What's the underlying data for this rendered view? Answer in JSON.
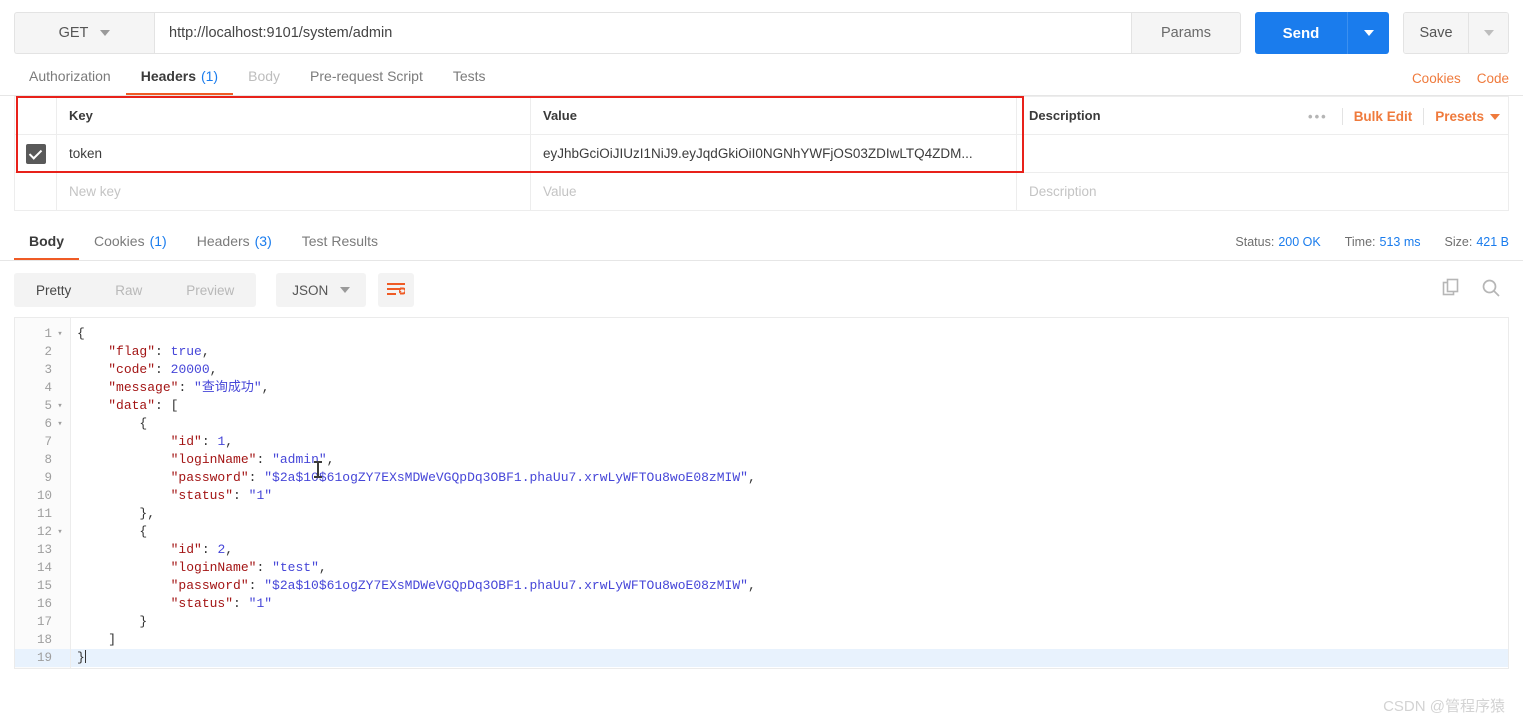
{
  "request": {
    "method": "GET",
    "url": "http://localhost:9101/system/admin",
    "params_label": "Params",
    "send_label": "Send",
    "save_label": "Save",
    "tabs": [
      {
        "label": "Authorization",
        "count": "",
        "state": "normal"
      },
      {
        "label": "Headers",
        "count": "(1)",
        "state": "active"
      },
      {
        "label": "Body",
        "count": "",
        "state": "dim"
      },
      {
        "label": "Pre-request Script",
        "count": "",
        "state": "normal"
      },
      {
        "label": "Tests",
        "count": "",
        "state": "normal"
      }
    ],
    "links": {
      "cookies": "Cookies",
      "code": "Code"
    }
  },
  "headers_table": {
    "columns": [
      "Key",
      "Value",
      "Description"
    ],
    "actions": {
      "dots": "•••",
      "bulk_edit": "Bulk Edit",
      "presets": "Presets"
    },
    "rows": [
      {
        "checked": true,
        "key": "token",
        "value": "eyJhbGciOiJIUzI1NiJ9.eyJqdGkiOiI0NGNhYWFjOS03ZDIwLTQ4ZDM...",
        "description": ""
      }
    ],
    "new_row": {
      "key_placeholder": "New key",
      "value_placeholder": "Value",
      "description_placeholder": "Description"
    }
  },
  "response": {
    "tabs": [
      {
        "label": "Body",
        "count": "",
        "state": "active"
      },
      {
        "label": "Cookies",
        "count": "(1)",
        "state": "normal"
      },
      {
        "label": "Headers",
        "count": "(3)",
        "state": "normal"
      },
      {
        "label": "Test Results",
        "count": "",
        "state": "normal"
      }
    ],
    "meta": {
      "status_label": "Status:",
      "status_value": "200 OK",
      "time_label": "Time:",
      "time_value": "513 ms",
      "size_label": "Size:",
      "size_value": "421 B"
    },
    "viewer": {
      "modes": [
        "Pretty",
        "Raw",
        "Preview"
      ],
      "active_mode": "Pretty",
      "format": "JSON",
      "wrap_icon": "word-wrap-icon",
      "copy_icon": "copy-icon",
      "search_icon": "search-icon"
    },
    "body_lines": [
      {
        "n": 1,
        "fold": true,
        "indent": 0,
        "tokens": [
          {
            "t": "p",
            "v": "{"
          }
        ],
        "hl": false
      },
      {
        "n": 2,
        "fold": false,
        "indent": 1,
        "tokens": [
          {
            "t": "k",
            "v": "\"flag\""
          },
          {
            "t": "p",
            "v": ": "
          },
          {
            "t": "n",
            "v": "true"
          },
          {
            "t": "p",
            "v": ","
          }
        ],
        "hl": false
      },
      {
        "n": 3,
        "fold": false,
        "indent": 1,
        "tokens": [
          {
            "t": "k",
            "v": "\"code\""
          },
          {
            "t": "p",
            "v": ": "
          },
          {
            "t": "n",
            "v": "20000"
          },
          {
            "t": "p",
            "v": ","
          }
        ],
        "hl": false
      },
      {
        "n": 4,
        "fold": false,
        "indent": 1,
        "tokens": [
          {
            "t": "k",
            "v": "\"message\""
          },
          {
            "t": "p",
            "v": ": "
          },
          {
            "t": "s",
            "v": "\"查询成功\""
          },
          {
            "t": "p",
            "v": ","
          }
        ],
        "hl": false
      },
      {
        "n": 5,
        "fold": true,
        "indent": 1,
        "tokens": [
          {
            "t": "k",
            "v": "\"data\""
          },
          {
            "t": "p",
            "v": ": ["
          }
        ],
        "hl": false
      },
      {
        "n": 6,
        "fold": true,
        "indent": 2,
        "tokens": [
          {
            "t": "p",
            "v": "{"
          }
        ],
        "hl": false
      },
      {
        "n": 7,
        "fold": false,
        "indent": 3,
        "tokens": [
          {
            "t": "k",
            "v": "\"id\""
          },
          {
            "t": "p",
            "v": ": "
          },
          {
            "t": "n",
            "v": "1"
          },
          {
            "t": "p",
            "v": ","
          }
        ],
        "hl": false
      },
      {
        "n": 8,
        "fold": false,
        "indent": 3,
        "tokens": [
          {
            "t": "k",
            "v": "\"loginName\""
          },
          {
            "t": "p",
            "v": ": "
          },
          {
            "t": "s",
            "v": "\"admin\""
          },
          {
            "t": "p",
            "v": ","
          }
        ],
        "hl": false
      },
      {
        "n": 9,
        "fold": false,
        "indent": 3,
        "tokens": [
          {
            "t": "k",
            "v": "\"password\""
          },
          {
            "t": "p",
            "v": ": "
          },
          {
            "t": "s",
            "v": "\"$2a$10$61ogZY7EXsMDWeVGQpDq3OBF1.phaUu7.xrwLyWFTOu8woE08zMIW\""
          },
          {
            "t": "p",
            "v": ","
          }
        ],
        "hl": false
      },
      {
        "n": 10,
        "fold": false,
        "indent": 3,
        "tokens": [
          {
            "t": "k",
            "v": "\"status\""
          },
          {
            "t": "p",
            "v": ": "
          },
          {
            "t": "s",
            "v": "\"1\""
          }
        ],
        "hl": false
      },
      {
        "n": 11,
        "fold": false,
        "indent": 2,
        "tokens": [
          {
            "t": "p",
            "v": "},"
          }
        ],
        "hl": false
      },
      {
        "n": 12,
        "fold": true,
        "indent": 2,
        "tokens": [
          {
            "t": "p",
            "v": "{"
          }
        ],
        "hl": false
      },
      {
        "n": 13,
        "fold": false,
        "indent": 3,
        "tokens": [
          {
            "t": "k",
            "v": "\"id\""
          },
          {
            "t": "p",
            "v": ": "
          },
          {
            "t": "n",
            "v": "2"
          },
          {
            "t": "p",
            "v": ","
          }
        ],
        "hl": false
      },
      {
        "n": 14,
        "fold": false,
        "indent": 3,
        "tokens": [
          {
            "t": "k",
            "v": "\"loginName\""
          },
          {
            "t": "p",
            "v": ": "
          },
          {
            "t": "s",
            "v": "\"test\""
          },
          {
            "t": "p",
            "v": ","
          }
        ],
        "hl": false
      },
      {
        "n": 15,
        "fold": false,
        "indent": 3,
        "tokens": [
          {
            "t": "k",
            "v": "\"password\""
          },
          {
            "t": "p",
            "v": ": "
          },
          {
            "t": "s",
            "v": "\"$2a$10$61ogZY7EXsMDWeVGQpDq3OBF1.phaUu7.xrwLyWFTOu8woE08zMIW\""
          },
          {
            "t": "p",
            "v": ","
          }
        ],
        "hl": false
      },
      {
        "n": 16,
        "fold": false,
        "indent": 3,
        "tokens": [
          {
            "t": "k",
            "v": "\"status\""
          },
          {
            "t": "p",
            "v": ": "
          },
          {
            "t": "s",
            "v": "\"1\""
          }
        ],
        "hl": false
      },
      {
        "n": 17,
        "fold": false,
        "indent": 2,
        "tokens": [
          {
            "t": "p",
            "v": "}"
          }
        ],
        "hl": false
      },
      {
        "n": 18,
        "fold": false,
        "indent": 1,
        "tokens": [
          {
            "t": "p",
            "v": "]"
          }
        ],
        "hl": false
      },
      {
        "n": 19,
        "fold": false,
        "indent": 0,
        "tokens": [
          {
            "t": "p",
            "v": "}"
          }
        ],
        "hl": true
      }
    ]
  },
  "watermark": "CSDN @管程序猿",
  "colors": {
    "accent_orange": "#ef5b25",
    "link_orange": "#ef7a3c",
    "send_blue": "#1a7ced",
    "annotation_red": "#e8211a",
    "json_key": "#a31515",
    "json_string": "#4646d8"
  }
}
